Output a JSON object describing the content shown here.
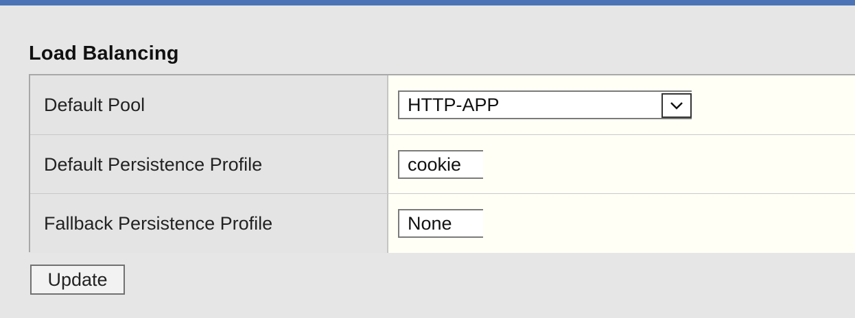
{
  "section": {
    "title": "Load Balancing"
  },
  "fields": [
    {
      "label": "Default Pool",
      "type": "select",
      "value": "HTTP-APP"
    },
    {
      "label": "Default Persistence Profile",
      "type": "input",
      "value": "cookie"
    },
    {
      "label": "Fallback Persistence Profile",
      "type": "input",
      "value": "None"
    }
  ],
  "actions": {
    "update_label": "Update"
  },
  "icons": {
    "dropdown": "chevron-down-icon"
  },
  "colors": {
    "top_strip": "#4b73b6",
    "page_background": "#e6e6e6",
    "value_background": "#fffff6"
  }
}
